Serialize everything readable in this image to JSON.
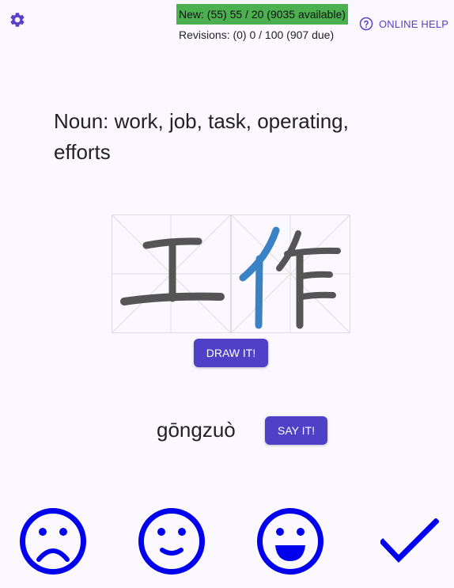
{
  "header": {
    "settings_icon": "gear-icon",
    "new_stat": "New: (55) 55 / 20 (9035 available)",
    "revision_stat": "Revisions: (0) 0 / 100 (907 due)",
    "help_icon": "question-circle-icon",
    "help_label": "ONLINE HELP"
  },
  "card": {
    "meaning": "Noun: work, job, task, operating, efforts",
    "characters": [
      "工",
      "作"
    ],
    "draw_label": "DRAW IT!",
    "pinyin": "gōngzuò",
    "say_label": "SAY IT!"
  },
  "rating": {
    "buttons": [
      "sad-face-icon",
      "smile-face-icon",
      "grin-face-icon",
      "checkmark-icon"
    ]
  },
  "colors": {
    "accent": "#5040c8",
    "new_badge": "#4caf50",
    "rating": "#0000ee",
    "stroke_gray": "#555555",
    "stroke_highlight": "#3b82c4"
  }
}
